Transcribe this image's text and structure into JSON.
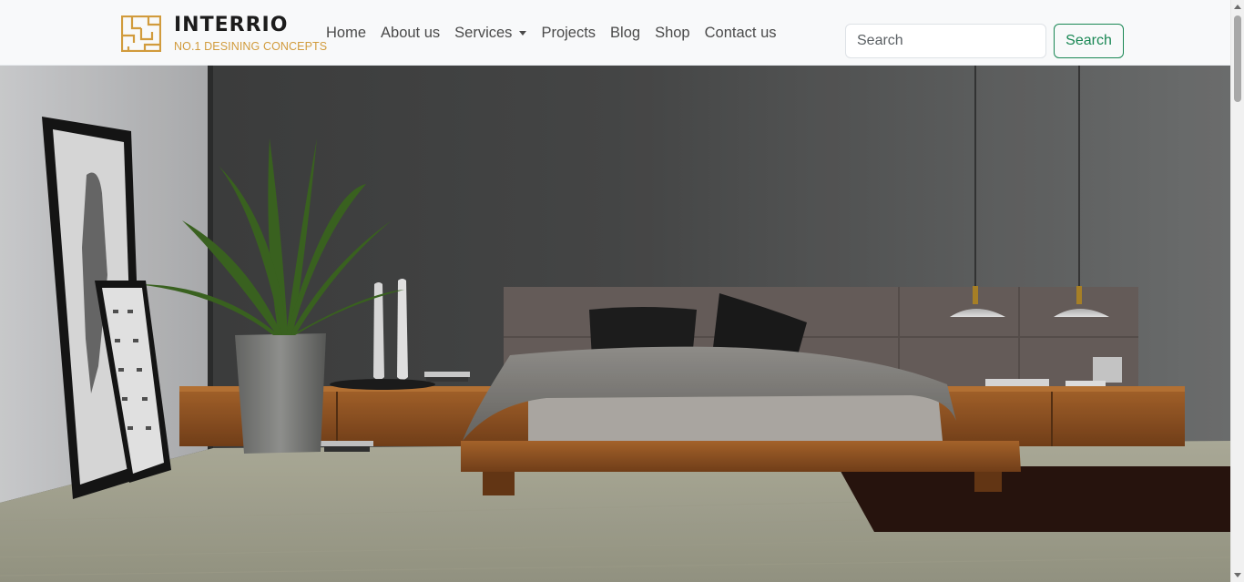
{
  "brand": {
    "name": "INTERRIO",
    "tagline": "NO.1 DESINING CONCEPTS",
    "accent_color": "#d19b3c"
  },
  "nav": {
    "items": [
      {
        "label": "Home"
      },
      {
        "label": "About us"
      },
      {
        "label": "Services",
        "dropdown": true
      },
      {
        "label": "Projects"
      },
      {
        "label": "Blog"
      },
      {
        "label": "Shop"
      },
      {
        "label": "Contact us"
      }
    ]
  },
  "search": {
    "placeholder": "Search",
    "value": "",
    "button_label": "Search",
    "button_color": "#198754"
  },
  "hero": {
    "icon": "bedroom-interior-image"
  }
}
